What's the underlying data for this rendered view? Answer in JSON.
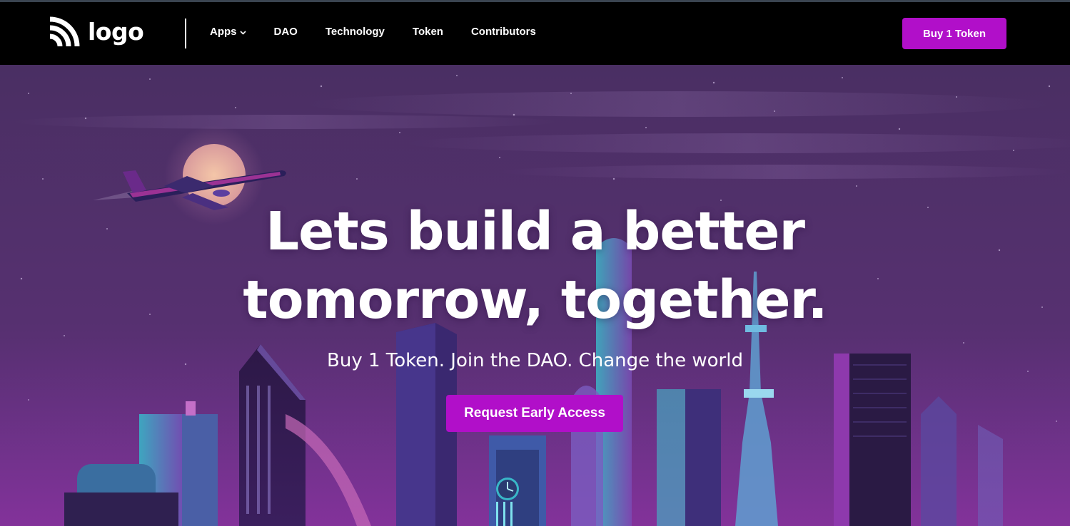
{
  "header": {
    "logo_text": "logo",
    "nav": [
      {
        "label": "Apps",
        "has_dropdown": true
      },
      {
        "label": "DAO"
      },
      {
        "label": "Technology"
      },
      {
        "label": "Token"
      },
      {
        "label": "Contributors"
      }
    ],
    "buy_button_label": "Buy 1 Token"
  },
  "hero": {
    "title_line1": "Lets build a better",
    "title_line2": "tomorrow, together.",
    "subtitle": "Buy 1 Token. Join the DAO. Change the world",
    "cta_label": "Request Early Access"
  },
  "colors": {
    "accent": "#b10fc9",
    "navbar_bg": "#000000",
    "sky_top": "#4a2f63",
    "sky_bottom": "#6b2a86"
  },
  "icons": {
    "logo": "rss-arcs-icon",
    "apps_dropdown": "chevron-down-icon"
  }
}
